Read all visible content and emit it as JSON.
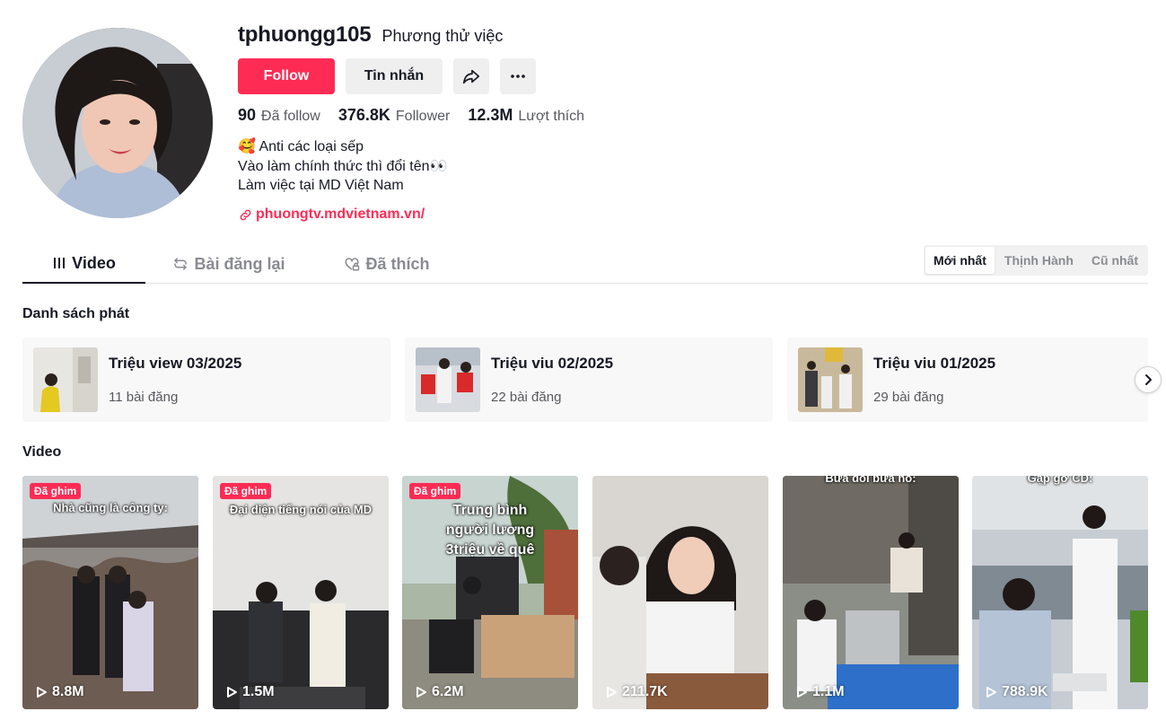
{
  "profile": {
    "username": "tphuongg105",
    "nickname": "Phương thử việc",
    "follow_label": "Follow",
    "message_label": "Tin nhắn",
    "stats": [
      {
        "num": "90",
        "label": "Đã follow"
      },
      {
        "num": "376.8K",
        "label": "Follower"
      },
      {
        "num": "12.3M",
        "label": "Lượt thích"
      }
    ],
    "bio": [
      "🥰 Anti các loại sếp",
      "Vào làm chính thức thì đổi tên👀",
      "Làm việc tại MD Việt Nam"
    ],
    "link": "phuongtv.mdvietnam.vn/"
  },
  "tabs": [
    {
      "label": "Video",
      "icon": "grid-icon"
    },
    {
      "label": "Bài đăng lại",
      "icon": "repost-icon"
    },
    {
      "label": "Đã thích",
      "icon": "heart-lock-icon"
    }
  ],
  "sort_options": [
    "Mới nhất",
    "Thịnh Hành",
    "Cũ nhất"
  ],
  "playlist_section": "Danh sách phát",
  "playlists": [
    {
      "title": "Triệu view 03/2025",
      "count": "11 bài đăng"
    },
    {
      "title": "Triệu viu 02/2025",
      "count": "22 bài đăng"
    },
    {
      "title": "Triệu viu 01/2025",
      "count": "29 bài đăng"
    }
  ],
  "video_section": "Video",
  "videos": [
    {
      "pin": "Đã ghim",
      "caption": "Nhà cũng là công ty:",
      "views": "8.8M"
    },
    {
      "pin": "Đã ghim",
      "caption": "Đại diện tiếng nói của MD",
      "views": "1.5M"
    },
    {
      "pin": "Đã ghim",
      "caption": "Trung bình người lương 3triệu về quê",
      "views": "6.2M"
    },
    {
      "pin": "",
      "caption": "",
      "views": "211.7K"
    },
    {
      "pin": "",
      "caption": "Bữa đói bữa no:",
      "views": "1.1M"
    },
    {
      "pin": "",
      "caption": "Gặp gỡ CD:",
      "views": "788.9K"
    }
  ],
  "colors": {
    "accent": "#fe2c55",
    "text": "#161823",
    "muted": "#58595f"
  }
}
